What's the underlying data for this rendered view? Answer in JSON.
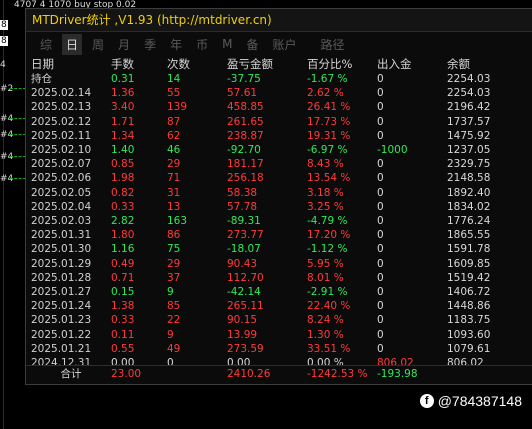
{
  "window": {
    "title": "MTDriver统计 ,V1.93 (http://mtdriver.cn)",
    "tabs": [
      "综",
      "日",
      "周",
      "月",
      "季",
      "年",
      "币",
      "M",
      "备",
      "账户",
      "路径"
    ],
    "active_tab": "日"
  },
  "table": {
    "headers": [
      "日期",
      "手数",
      "次数",
      "盈亏金额",
      "百分比%",
      "出入金",
      "余额"
    ],
    "rows": [
      {
        "date": "持仓",
        "lots": "0.31",
        "count": "14",
        "pnl": "-37.75",
        "pct": "-1.67 %",
        "flow": "0",
        "balance": "2254.03",
        "tone": "neg"
      },
      {
        "date": "2025.02.14",
        "lots": "1.36",
        "count": "55",
        "pnl": "57.61",
        "pct": "2.62 %",
        "flow": "0",
        "balance": "2254.03",
        "tone": "pos"
      },
      {
        "date": "2025.02.13",
        "lots": "3.40",
        "count": "139",
        "pnl": "458.85",
        "pct": "26.41 %",
        "flow": "0",
        "balance": "2196.42",
        "tone": "pos"
      },
      {
        "date": "2025.02.12",
        "lots": "1.71",
        "count": "87",
        "pnl": "261.65",
        "pct": "17.73 %",
        "flow": "0",
        "balance": "1737.57",
        "tone": "pos"
      },
      {
        "date": "2025.02.11",
        "lots": "1.34",
        "count": "62",
        "pnl": "238.87",
        "pct": "19.31 %",
        "flow": "0",
        "balance": "1475.92",
        "tone": "pos"
      },
      {
        "date": "2025.02.10",
        "lots": "1.40",
        "count": "46",
        "pnl": "-92.70",
        "pct": "-6.97 %",
        "flow": "-1000",
        "balance": "1237.05",
        "tone": "neg"
      },
      {
        "date": "2025.02.07",
        "lots": "0.85",
        "count": "29",
        "pnl": "181.17",
        "pct": "8.43 %",
        "flow": "0",
        "balance": "2329.75",
        "tone": "pos"
      },
      {
        "date": "2025.02.06",
        "lots": "1.98",
        "count": "71",
        "pnl": "256.18",
        "pct": "13.54 %",
        "flow": "0",
        "balance": "2148.58",
        "tone": "pos"
      },
      {
        "date": "2025.02.05",
        "lots": "0.82",
        "count": "31",
        "pnl": "58.38",
        "pct": "3.18 %",
        "flow": "0",
        "balance": "1892.40",
        "tone": "pos"
      },
      {
        "date": "2025.02.04",
        "lots": "0.33",
        "count": "13",
        "pnl": "57.78",
        "pct": "3.25 %",
        "flow": "0",
        "balance": "1834.02",
        "tone": "pos"
      },
      {
        "date": "2025.02.03",
        "lots": "2.82",
        "count": "163",
        "pnl": "-89.31",
        "pct": "-4.79 %",
        "flow": "0",
        "balance": "1776.24",
        "tone": "neg"
      },
      {
        "date": "2025.01.31",
        "lots": "1.80",
        "count": "86",
        "pnl": "273.77",
        "pct": "17.20 %",
        "flow": "0",
        "balance": "1865.55",
        "tone": "pos"
      },
      {
        "date": "2025.01.30",
        "lots": "1.16",
        "count": "75",
        "pnl": "-18.07",
        "pct": "-1.12 %",
        "flow": "0",
        "balance": "1591.78",
        "tone": "neg"
      },
      {
        "date": "2025.01.29",
        "lots": "0.49",
        "count": "29",
        "pnl": "90.43",
        "pct": "5.95 %",
        "flow": "0",
        "balance": "1609.85",
        "tone": "pos"
      },
      {
        "date": "2025.01.28",
        "lots": "0.71",
        "count": "37",
        "pnl": "112.70",
        "pct": "8.01 %",
        "flow": "0",
        "balance": "1519.42",
        "tone": "pos"
      },
      {
        "date": "2025.01.27",
        "lots": "0.15",
        "count": "9",
        "pnl": "-42.14",
        "pct": "-2.91 %",
        "flow": "0",
        "balance": "1406.72",
        "tone": "neg"
      },
      {
        "date": "2025.01.24",
        "lots": "1.38",
        "count": "85",
        "pnl": "265.11",
        "pct": "22.40 %",
        "flow": "0",
        "balance": "1448.86",
        "tone": "pos"
      },
      {
        "date": "2025.01.23",
        "lots": "0.33",
        "count": "22",
        "pnl": "90.15",
        "pct": "8.24 %",
        "flow": "0",
        "balance": "1183.75",
        "tone": "pos"
      },
      {
        "date": "2025.01.22",
        "lots": "0.11",
        "count": "9",
        "pnl": "13.99",
        "pct": "1.30 %",
        "flow": "0",
        "balance": "1093.60",
        "tone": "pos"
      },
      {
        "date": "2025.01.21",
        "lots": "0.55",
        "count": "49",
        "pnl": "273.59",
        "pct": "33.51 %",
        "flow": "0",
        "balance": "1079.61",
        "tone": "pos"
      },
      {
        "date": "2024.12.31",
        "lots": "0.00",
        "count": "0",
        "pnl": "0.00",
        "pct": "0.00 %",
        "flow": "806.02",
        "balance": "806.02",
        "tone": "neu"
      }
    ],
    "total": {
      "label": "合计",
      "lots": "23.00",
      "pnl": "2410.26",
      "pct": "-1242.53 %",
      "flow": "-193.98"
    }
  },
  "background": {
    "top_text": "4707 4 1070 buy stop 0.02",
    "ticks": [
      "#2",
      "#4",
      "#4",
      "#4",
      "#4",
      "#4"
    ],
    "side_labels": [
      "8",
      "8",
      "4"
    ]
  },
  "watermark": "@784387148",
  "colors": {
    "title": "#f0d000",
    "positive": "#ff3a3a",
    "negative": "#2ee85c"
  }
}
